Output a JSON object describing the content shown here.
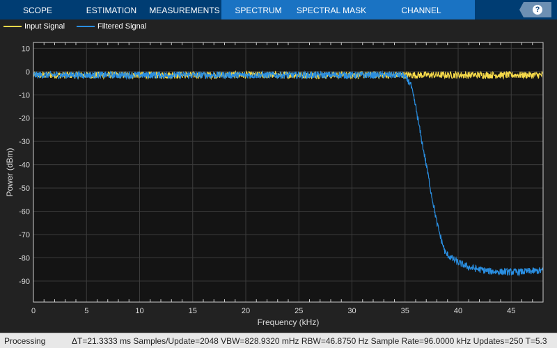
{
  "tabs": [
    "SCOPE",
    "ESTIMATION",
    "MEASUREMENTS",
    "SPECTRUM",
    "SPECTRAL MASK",
    "CHANNEL MEASUREMENTS"
  ],
  "help_icon": "?",
  "status": {
    "state": "Processing",
    "info": "ΔT=21.3333 ms  Samples/Update=2048  VBW=828.9320 mHz  RBW=46.8750 Hz  Sample Rate=96.0000 kHz  Updates=250  T=5.3"
  },
  "chart_data": {
    "type": "line",
    "title": "",
    "xlabel": "Frequency (kHz)",
    "ylabel": "Power (dBm)",
    "xlim": [
      0,
      48
    ],
    "ylim": [
      -99,
      12.5
    ],
    "xticks": [
      0,
      5,
      10,
      15,
      20,
      25,
      30,
      35,
      40,
      45
    ],
    "yticks": [
      10,
      0,
      -10,
      -20,
      -30,
      -40,
      -50,
      -60,
      -70,
      -80,
      -90
    ],
    "grid": true,
    "legend": "top-left",
    "series": [
      {
        "name": "Input Signal",
        "color": "#f5d94a",
        "x": [
          0,
          48
        ],
        "y": [
          -1.5,
          -1.5
        ],
        "noise_db": 1.5
      },
      {
        "name": "Filtered Signal",
        "color": "#2a8ee0",
        "x": [
          0,
          34.8,
          35.5,
          36,
          36.5,
          37,
          37.5,
          38,
          38.4,
          38.8,
          39.5,
          40,
          41,
          42,
          43,
          44,
          45,
          46,
          47,
          48
        ],
        "y": [
          -1.5,
          -1.5,
          -5,
          -15,
          -28,
          -40,
          -53,
          -65,
          -72,
          -78,
          -80.5,
          -82,
          -84,
          -85,
          -85.8,
          -86,
          -86.1,
          -86,
          -85.7,
          -85.5
        ],
        "noise_db": 1.5
      }
    ]
  }
}
